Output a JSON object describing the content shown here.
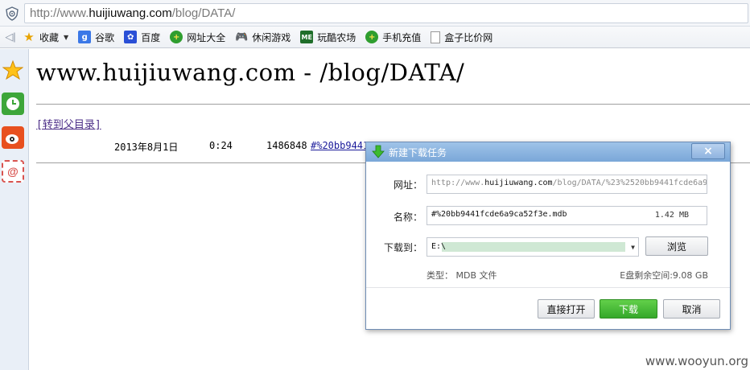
{
  "address_bar": {
    "url_prefix": "http://www.",
    "url_domain": "huijiuwang.com",
    "url_path": "/blog/DATA/"
  },
  "favorites_bar": {
    "items": [
      {
        "label": "收藏",
        "icon": "star-icon"
      },
      {
        "label": "谷歌",
        "icon": "google-icon"
      },
      {
        "label": "百度",
        "icon": "baidu-paw-icon"
      },
      {
        "label": "网址大全",
        "icon": "green-plus-icon"
      },
      {
        "label": "休闲游戏",
        "icon": "gamepad-icon"
      },
      {
        "label": "玩酷农场",
        "icon": "me-icon"
      },
      {
        "label": "手机充值",
        "icon": "green-plus-icon"
      },
      {
        "label": "盒子比价网",
        "icon": "document-icon"
      }
    ]
  },
  "sidebar": {
    "items": [
      "star-icon",
      "clock-icon",
      "weibo-icon",
      "mail-stamp-icon"
    ]
  },
  "page": {
    "title": "www.huijiuwang.com - /blog/DATA/",
    "parent_link": "[转到父目录]",
    "file_row": {
      "date": "2013年8月1日",
      "time": "0:24",
      "size": "1486848",
      "name": "#%20bb9441"
    },
    "watermark": "www.wooyun.org"
  },
  "dialog": {
    "title": "新建下载任务",
    "close_label": "×",
    "url_label": "网址：",
    "url_prefix": "http://www.",
    "url_domain": "huijiuwang.com",
    "url_rest": "/blog/DATA/%23%2520bb9441fcde6a9",
    "name_label": "名称：",
    "name_value": "#%20bb9441fcde6a9ca52f3e.mdb",
    "size_value": "1.42 MB",
    "dest_label": "下载到：",
    "dest_value": "E:\\",
    "browse_label": "浏览",
    "type_label": "类型： MDB 文件",
    "free_space": "E盘剩余空间:9.08 GB",
    "open_label": "直接打开",
    "download_label": "下载",
    "cancel_label": "取消"
  },
  "colors": {
    "download_button": "#3db32e",
    "dialog_title_bar": "#8ab3df",
    "link": "#1a1a9a"
  }
}
